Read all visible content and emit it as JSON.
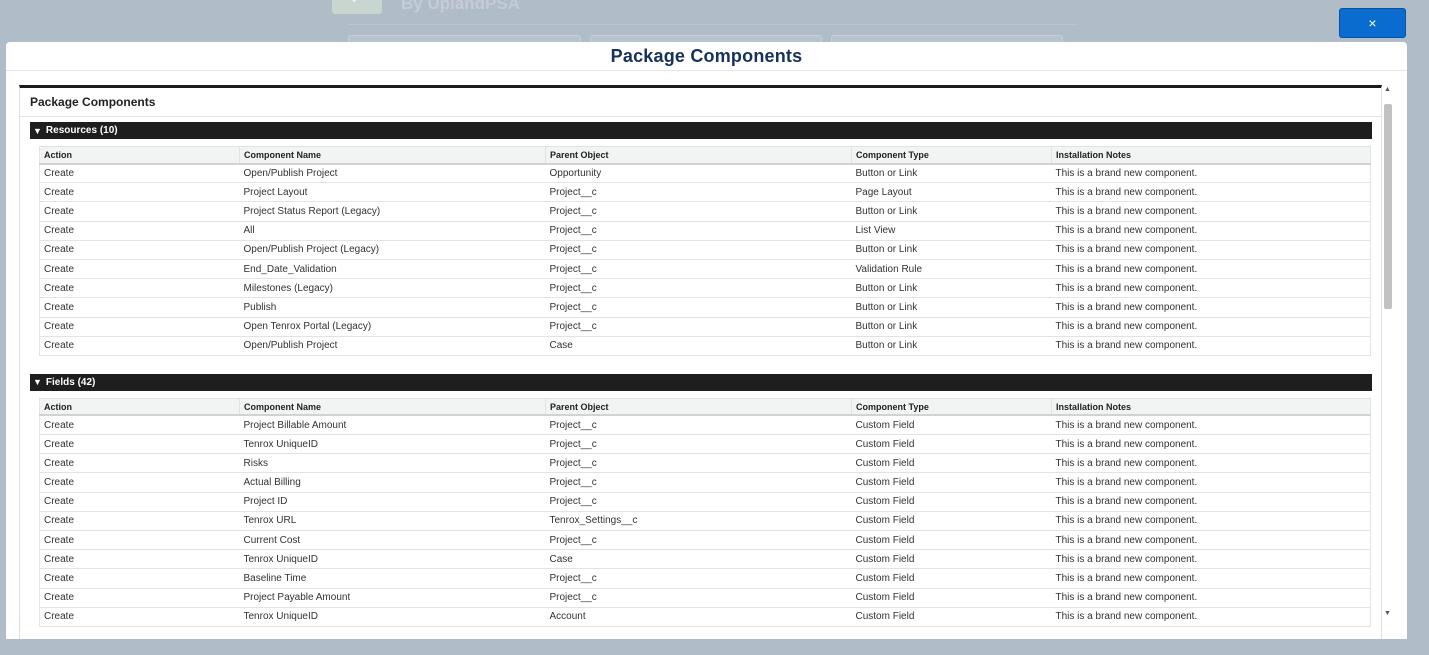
{
  "background": {
    "title": "By UplandPSA"
  },
  "close_button": {
    "label": "×"
  },
  "modal": {
    "title": "Package Components",
    "panel_title": "Package Components",
    "columns": [
      "Action",
      "Component Name",
      "Parent Object",
      "Component Type",
      "Installation Notes"
    ],
    "sections": [
      {
        "title": "Resources (10)",
        "rows": [
          [
            "Create",
            "Open/Publish Project",
            "Opportunity",
            "Button or Link",
            "This is a brand new component."
          ],
          [
            "Create",
            "Project Layout",
            "Project__c",
            "Page Layout",
            "This is a brand new component."
          ],
          [
            "Create",
            "Project Status Report (Legacy)",
            "Project__c",
            "Button or Link",
            "This is a brand new component."
          ],
          [
            "Create",
            "All",
            "Project__c",
            "List View",
            "This is a brand new component."
          ],
          [
            "Create",
            "Open/Publish Project (Legacy)",
            "Project__c",
            "Button or Link",
            "This is a brand new component."
          ],
          [
            "Create",
            "End_Date_Validation",
            "Project__c",
            "Validation Rule",
            "This is a brand new component."
          ],
          [
            "Create",
            "Milestones (Legacy)",
            "Project__c",
            "Button or Link",
            "This is a brand new component."
          ],
          [
            "Create",
            "Publish",
            "Project__c",
            "Button or Link",
            "This is a brand new component."
          ],
          [
            "Create",
            "Open Tenrox Portal (Legacy)",
            "Project__c",
            "Button or Link",
            "This is a brand new component."
          ],
          [
            "Create",
            "Open/Publish Project",
            "Case",
            "Button or Link",
            "This is a brand new component."
          ]
        ]
      },
      {
        "title": "Fields (42)",
        "rows": [
          [
            "Create",
            "Project Billable Amount",
            "Project__c",
            "Custom Field",
            "This is a brand new component."
          ],
          [
            "Create",
            "Tenrox UniqueID",
            "Project__c",
            "Custom Field",
            "This is a brand new component."
          ],
          [
            "Create",
            "Risks",
            "Project__c",
            "Custom Field",
            "This is a brand new component."
          ],
          [
            "Create",
            "Actual Billing",
            "Project__c",
            "Custom Field",
            "This is a brand new component."
          ],
          [
            "Create",
            "Project ID",
            "Project__c",
            "Custom Field",
            "This is a brand new component."
          ],
          [
            "Create",
            "Tenrox URL",
            "Tenrox_Settings__c",
            "Custom Field",
            "This is a brand new component."
          ],
          [
            "Create",
            "Current Cost",
            "Project__c",
            "Custom Field",
            "This is a brand new component."
          ],
          [
            "Create",
            "Tenrox UniqueID",
            "Case",
            "Custom Field",
            "This is a brand new component."
          ],
          [
            "Create",
            "Baseline Time",
            "Project__c",
            "Custom Field",
            "This is a brand new component."
          ],
          [
            "Create",
            "Project Payable Amount",
            "Project__c",
            "Custom Field",
            "This is a brand new component."
          ],
          [
            "Create",
            "Tenrox UniqueID",
            "Account",
            "Custom Field",
            "This is a brand new component."
          ]
        ]
      }
    ]
  },
  "icons": {
    "close": "close-icon",
    "section_toggle": "triangle-down-icon",
    "scroll_up": "scroll-up-arrow-icon",
    "scroll_down": "scroll-down-arrow-icon"
  },
  "colors": {
    "close_button_bg": "#0a6ccf",
    "modal_title": "#16325c",
    "section_header_bg": "#1e1e1e"
  }
}
